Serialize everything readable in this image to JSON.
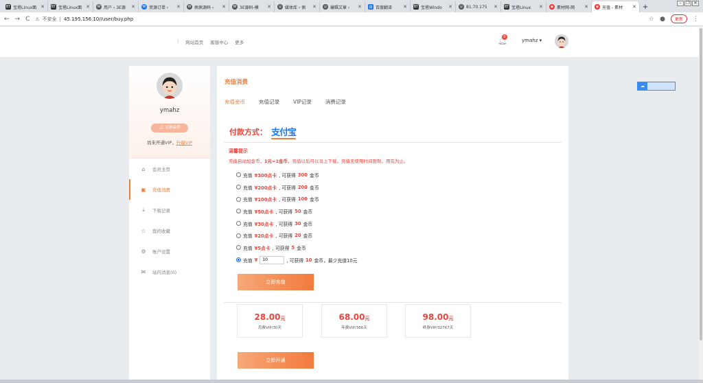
{
  "browser": {
    "tabs": [
      {
        "label": "宝塔Linux面",
        "fav": "BT"
      },
      {
        "label": "宝塔Linux面",
        "fav": "BT"
      },
      {
        "label": "用户 ‹ 3E源",
        "fav": "W"
      },
      {
        "label": "资源订单 ‹",
        "fav": "W"
      },
      {
        "label": "佩佩源码 ‹",
        "fav": "W"
      },
      {
        "label": "3E源码-模",
        "fav": "W"
      },
      {
        "label": "媒体库 ‹ 佩",
        "fav": "◎"
      },
      {
        "label": "编辑文章 ‹",
        "fav": "◎"
      },
      {
        "label": "百度翻译",
        "fav": "译"
      },
      {
        "label": "宝塔Windo",
        "fav": "BT"
      },
      {
        "label": "81.70.175",
        "fav": "◎"
      },
      {
        "label": "宝塔Linux",
        "fav": "BT"
      },
      {
        "label": "素材网-网",
        "fav": "◉"
      },
      {
        "label": "充值 - 素材",
        "fav": "◉"
      }
    ],
    "new_tab": "+",
    "insecure_label": "不安全",
    "url_host": "45.195.156.10",
    "url_path": "//user/buy.php",
    "update_label": "更新"
  },
  "site": {
    "nav": [
      "网站首页",
      "客服中心",
      "更多"
    ],
    "nav_sep": "|",
    "notif_count": "0",
    "username": "ymahz ▾"
  },
  "sidebar": {
    "username": "ymahz",
    "reg_badge": "注册会员",
    "vip_text": "尚未开通VIP，",
    "vip_link": "升级VIP",
    "menu": [
      {
        "label": "会员主页",
        "icon": "home-icon"
      },
      {
        "label": "充值消费",
        "icon": "wallet-icon"
      },
      {
        "label": "下载记录",
        "icon": "download-icon"
      },
      {
        "label": "我的收藏",
        "icon": "star-icon"
      },
      {
        "label": "账户设置",
        "icon": "gear-icon"
      },
      {
        "label": "站内消息(0)",
        "icon": "mail-icon"
      }
    ]
  },
  "main": {
    "title": "充值消费",
    "tabs": [
      "充值金币",
      "充值记录",
      "VIP记录",
      "消费记录"
    ],
    "pay_label": "付款方式：",
    "pay_brand": "支付宝",
    "tip_head": "温馨提示",
    "tip_pre": "充值自动加金币，",
    "tip_bold": "1元=1金币",
    "tip_post": "，充值以后可以马上下载，充值无使用时间限制，用完为止。",
    "options": [
      {
        "pre": "充值",
        "card": "¥300点卡",
        "mid": ", 可获得",
        "coins": "300",
        "post": "金币"
      },
      {
        "pre": "充值",
        "card": "¥200点卡",
        "mid": ", 可获得",
        "coins": "200",
        "post": "金币"
      },
      {
        "pre": "充值",
        "card": "¥100点卡",
        "mid": ", 可获得",
        "coins": "100",
        "post": "金币"
      },
      {
        "pre": "充值",
        "card": "¥50点卡",
        "mid": ", 可获得",
        "coins": "50",
        "post": "金币"
      },
      {
        "pre": "充值",
        "card": "¥30点卡",
        "mid": ", 可获得",
        "coins": "30",
        "post": "金币"
      },
      {
        "pre": "充值",
        "card": "¥20点卡",
        "mid": ", 可获得",
        "coins": "20",
        "post": "金币"
      },
      {
        "pre": "充值",
        "card": "¥5点卡",
        "mid": ", 可获得",
        "coins": "5",
        "post": "金币"
      }
    ],
    "custom": {
      "pre": "充值",
      "yen": "¥",
      "value": "10",
      "mid": ", 可获得",
      "coins": "10",
      "post": "金币，最少充值10元"
    },
    "recharge_btn": "立即充值",
    "vip_cards": [
      {
        "price": "28.00",
        "unit": "元",
        "desc": "月费VIP/30天"
      },
      {
        "price": "68.00",
        "unit": "元",
        "desc": "年费VIP/366天"
      },
      {
        "price": "98.00",
        "unit": "元",
        "desc": "终身VIP/32767天"
      }
    ],
    "open_btn": "立即开通"
  },
  "colors": {
    "accent": "#f07f3c",
    "price_red": "#e8453c",
    "alipay_blue": "#1677ff"
  }
}
